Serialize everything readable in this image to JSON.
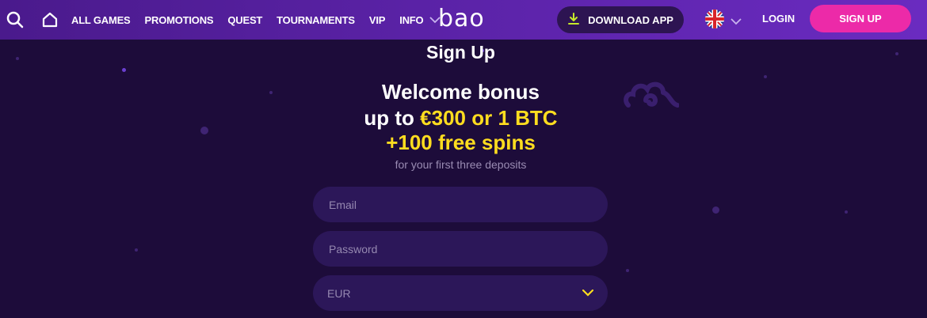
{
  "header": {
    "nav": {
      "all_games": "ALL GAMES",
      "promotions": "PROMOTIONS",
      "quest": "QUEST",
      "tournaments": "TOURNAMENTS",
      "vip": "VIP",
      "info": "INFO"
    },
    "logo": "bao",
    "download_label": "DOWNLOAD APP",
    "login_label": "LOGIN",
    "signup_label": "SIGN UP",
    "language_icon": "uk-flag-icon"
  },
  "signup": {
    "title": "Sign Up",
    "bonus_line1": "Welcome bonus",
    "bonus_line2_prefix": "up to ",
    "bonus_line2_amount": "€300 or 1 BTC",
    "bonus_line3": "+100 free spins",
    "subtext": "for your first three deposits",
    "email_placeholder": "Email",
    "password_placeholder": "Password",
    "currency_value": "EUR"
  },
  "colors": {
    "background": "#1d0c3a",
    "header": "#5a22a6",
    "accent_pink": "#ec2aa8",
    "highlight_yellow": "#ffdd1f",
    "field_bg": "#2c1759"
  }
}
